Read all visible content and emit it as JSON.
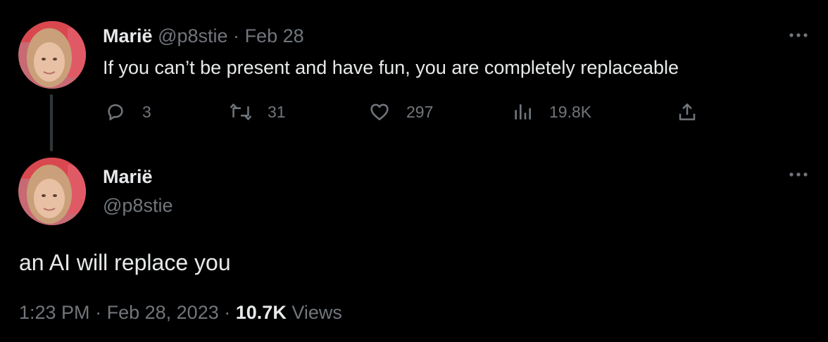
{
  "parent_tweet": {
    "author_name": "Marië",
    "handle": "@p8stie",
    "separator": "·",
    "date": "Feb 28",
    "text": "If you can’t be present and have fun, you are completely replaceable",
    "actions": {
      "replies": "3",
      "retweets": "31",
      "likes": "297",
      "views": "19.8K"
    }
  },
  "main_tweet": {
    "author_name": "Marië",
    "handle": "@p8stie",
    "text": "an AI will replace you",
    "time": "1:23 PM",
    "separator_1": "·",
    "date": "Feb 28, 2023",
    "separator_2": "·",
    "views_count": "10.7K",
    "views_label": "Views"
  },
  "icons": {
    "reply": "reply-icon",
    "retweet": "retweet-icon",
    "like": "heart-icon",
    "views": "bar-chart-icon",
    "share": "share-icon",
    "more": "more-icon"
  },
  "colors": {
    "background": "#000000",
    "primary_text": "#e7e9ea",
    "secondary_text": "#71767b",
    "thread_line": "#333639"
  }
}
